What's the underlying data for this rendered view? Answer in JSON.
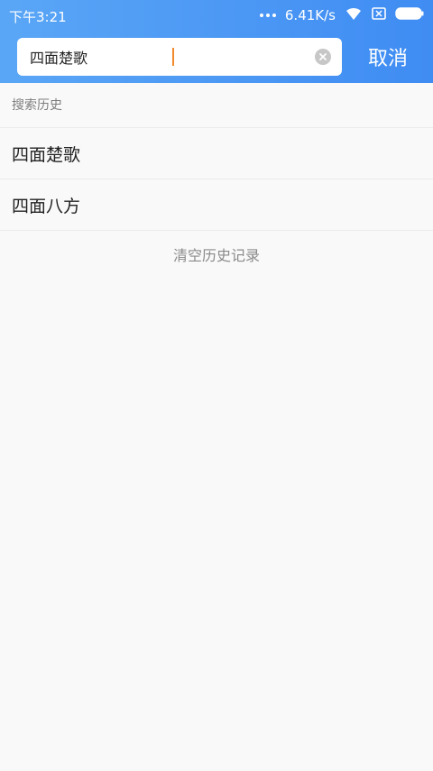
{
  "status_bar": {
    "time": "下午3:21",
    "net_speed": "6.41K/s"
  },
  "search": {
    "value": "四面楚歌",
    "cancel_label": "取消"
  },
  "history": {
    "title": "搜索历史",
    "items": [
      {
        "label": "四面楚歌"
      },
      {
        "label": "四面八方"
      }
    ],
    "clear_label": "清空历史记录"
  }
}
